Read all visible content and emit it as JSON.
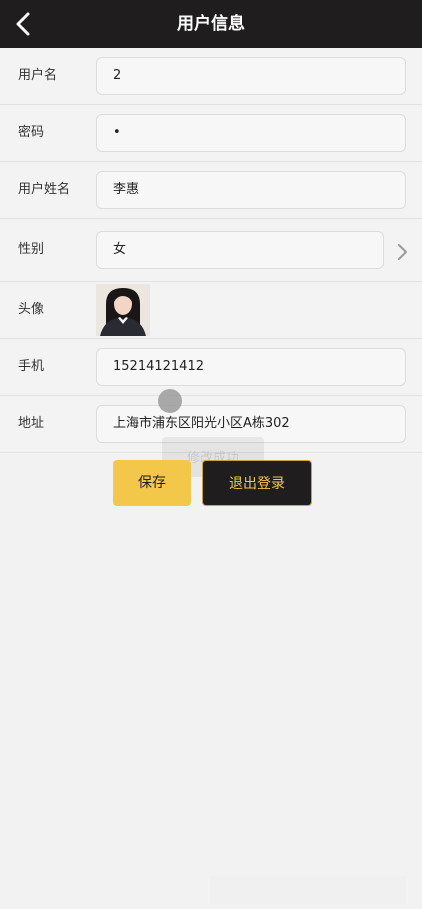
{
  "header": {
    "title": "用户信息"
  },
  "form": {
    "username": {
      "label": "用户名",
      "value": "2"
    },
    "password": {
      "label": "密码",
      "value": "•"
    },
    "realname": {
      "label": "用户姓名",
      "value": "李惠"
    },
    "gender": {
      "label": "性别",
      "value": "女"
    },
    "avatar": {
      "label": "头像"
    },
    "phone": {
      "label": "手机",
      "value": "15214121412"
    },
    "address": {
      "label": "地址",
      "value": "上海市浦东区阳光小区A栋302"
    }
  },
  "buttons": {
    "save": "保存",
    "logout": "退出登录"
  },
  "toast": {
    "text": "修改成功"
  },
  "colors": {
    "header_bg": "#1f1d1e",
    "accent": "#f3c84a"
  }
}
